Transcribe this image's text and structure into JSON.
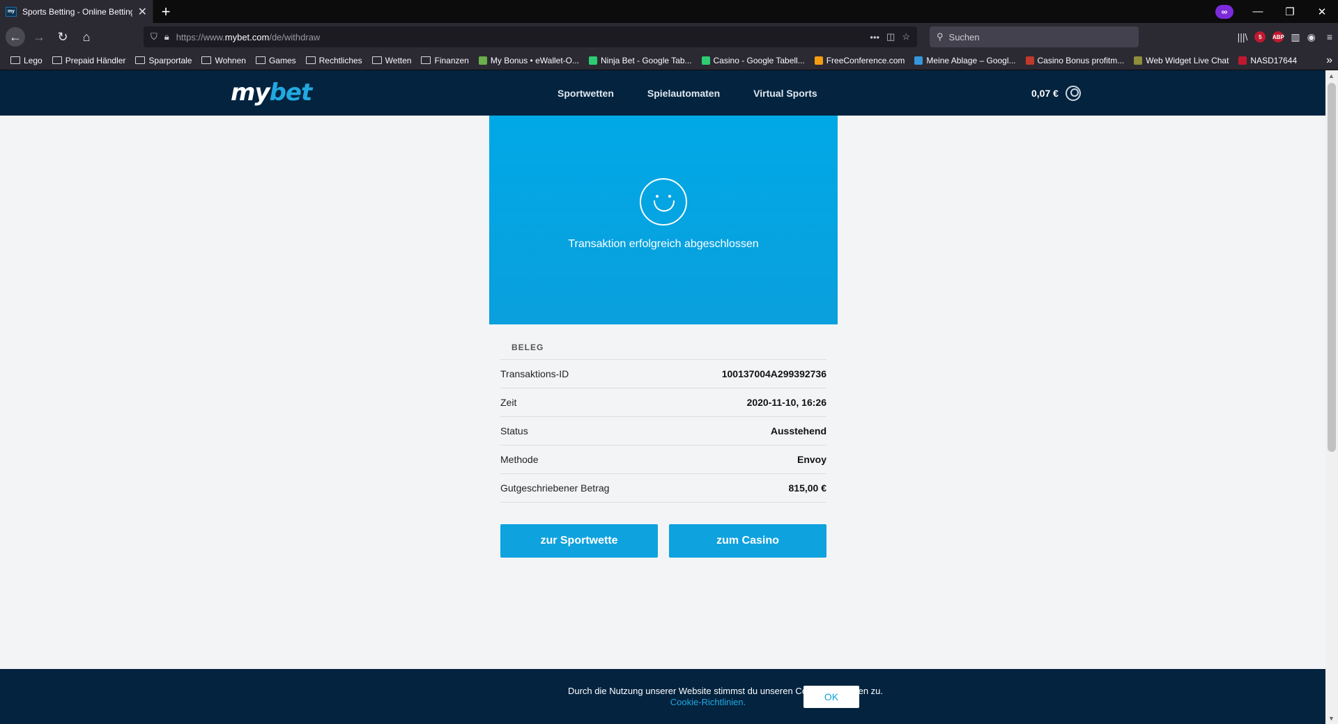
{
  "browser": {
    "tab_title": "Sports Betting - Online Betting",
    "url_prefix": "https://www.",
    "url_domain": "mybet.com",
    "url_path": "/de/withdraw",
    "search_placeholder": "Suchen",
    "bookmarks": [
      "Lego",
      "Prepaid Händler",
      "Sparportale",
      "Wohnen",
      "Games",
      "Rechtliches",
      "Wetten",
      "Finanzen",
      "My Bonus • eWallet-O...",
      "Ninja Bet - Google Tab...",
      "Casino - Google Tabell...",
      "FreeConference.com",
      "Meine Ablage – Googl...",
      "Casino Bonus profitm...",
      "Web Widget Live Chat",
      "NASD17644"
    ],
    "ublock_count": "5"
  },
  "site": {
    "logo_a": "my",
    "logo_b": "bet",
    "nav": [
      "Sportwetten",
      "Spielautomaten",
      "Virtual Sports"
    ],
    "balance": "0,07 €"
  },
  "hero": {
    "message": "Transaktion erfolgreich abgeschlossen"
  },
  "receipt": {
    "label": "BELEG",
    "rows": [
      {
        "k": "Transaktions-ID",
        "v": "100137004A299392736"
      },
      {
        "k": "Zeit",
        "v": "2020-11-10, 16:26"
      },
      {
        "k": "Status",
        "v": "Ausstehend"
      },
      {
        "k": "Methode",
        "v": "Envoy"
      },
      {
        "k": "Gutgeschriebener Betrag",
        "v": "815,00 €"
      }
    ]
  },
  "buttons": {
    "sport": "zur Sportwette",
    "casino": "zum Casino"
  },
  "cookie": {
    "text": "Durch die Nutzung unserer Website stimmst du unseren Cookie-Richtlinien zu.",
    "link": "Cookie-Richtlinien.",
    "ok": "OK"
  }
}
